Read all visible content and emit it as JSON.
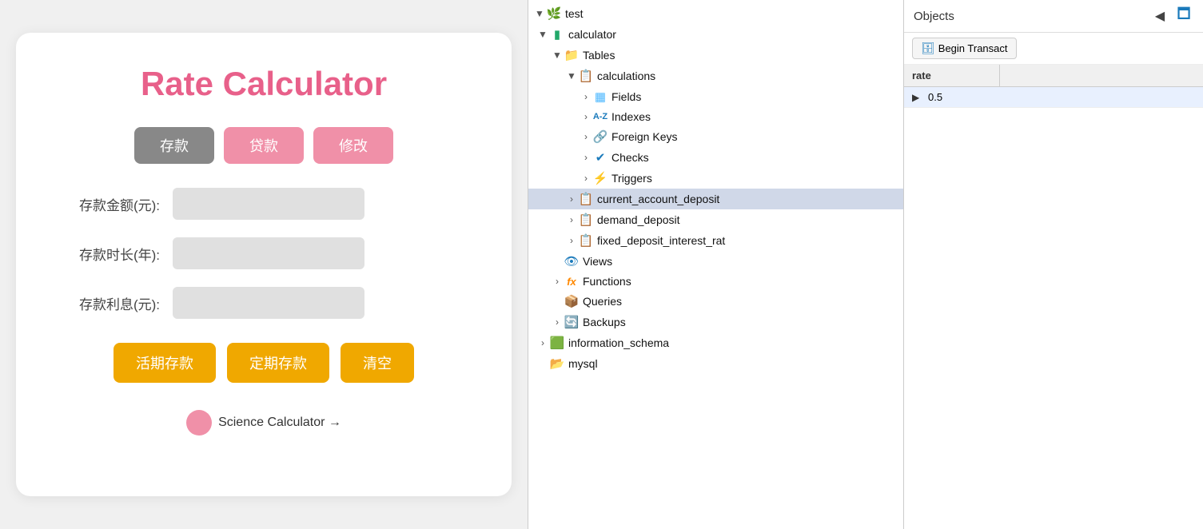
{
  "calculator": {
    "title": "Rate Calculator",
    "mode_buttons": [
      {
        "label": "存款",
        "style": "active-gray"
      },
      {
        "label": "贷款",
        "style": "active-pink"
      },
      {
        "label": "修改",
        "style": "active-pink"
      }
    ],
    "fields": [
      {
        "label": "存款金额(元):",
        "placeholder": ""
      },
      {
        "label": "存款时长(年):",
        "placeholder": ""
      },
      {
        "label": "存款利息(元):",
        "placeholder": ""
      }
    ],
    "action_buttons": [
      {
        "label": "活期存款"
      },
      {
        "label": "定期存款"
      },
      {
        "label": "清空"
      }
    ],
    "science_link": "Science Calculator →"
  },
  "tree": {
    "items": [
      {
        "indent": 0,
        "arrow": "▼",
        "icon": "🌿",
        "label": "test",
        "icon_class": "icon-green"
      },
      {
        "indent": 1,
        "arrow": "▼",
        "icon": "🟩",
        "label": "calculator",
        "icon_class": "icon-green"
      },
      {
        "indent": 2,
        "arrow": "▼",
        "icon": "📁",
        "label": "Tables",
        "icon_class": "icon-blue"
      },
      {
        "indent": 3,
        "arrow": "▼",
        "icon": "📋",
        "label": "calculations",
        "icon_class": "icon-blue"
      },
      {
        "indent": 4,
        "arrow": "›",
        "icon": "▦",
        "label": "Fields",
        "icon_class": "icon-lightblue"
      },
      {
        "indent": 4,
        "arrow": "›",
        "icon": "A-Z",
        "label": "Indexes",
        "icon_class": "icon-blue"
      },
      {
        "indent": 4,
        "arrow": "›",
        "icon": "🔗",
        "label": "Foreign Keys",
        "icon_class": "icon-blue"
      },
      {
        "indent": 4,
        "arrow": "›",
        "icon": "✔",
        "label": "Checks",
        "icon_class": "icon-blue"
      },
      {
        "indent": 4,
        "arrow": "›",
        "icon": "⚡",
        "label": "Triggers",
        "icon_class": "icon-yellow"
      },
      {
        "indent": 3,
        "arrow": "›",
        "icon": "📋",
        "label": "current_account_deposit",
        "icon_class": "icon-blue",
        "selected": true
      },
      {
        "indent": 3,
        "arrow": "›",
        "icon": "📋",
        "label": "demand_deposit",
        "icon_class": "icon-blue"
      },
      {
        "indent": 3,
        "arrow": "›",
        "icon": "📋",
        "label": "fixed_deposit_interest_rat",
        "icon_class": "icon-blue"
      },
      {
        "indent": 2,
        "arrow": "",
        "icon": "👁",
        "label": "Views",
        "icon_class": "icon-blue"
      },
      {
        "indent": 2,
        "arrow": "›",
        "icon": "fx",
        "label": "Functions",
        "icon_class": "icon-orange"
      },
      {
        "indent": 2,
        "arrow": "",
        "icon": "📦",
        "label": "Queries",
        "icon_class": "icon-blue"
      },
      {
        "indent": 2,
        "arrow": "›",
        "icon": "🔄",
        "label": "Backups",
        "icon_class": "icon-gray"
      },
      {
        "indent": 1,
        "arrow": "›",
        "icon": "🟩",
        "label": "information_schema",
        "icon_class": "icon-green"
      },
      {
        "indent": 1,
        "arrow": "",
        "icon": "📂",
        "label": "mysql",
        "icon_class": "icon-blue"
      }
    ]
  },
  "objects_panel": {
    "title": "Objects",
    "toolbar_btn": "Begin Transact",
    "table_header": "rate",
    "table_row": {
      "arrow": "▶",
      "value": "0.5"
    }
  },
  "icons": {
    "chevron-up": "▲",
    "chevron-collapse": "◀",
    "window-max": "🗖"
  }
}
